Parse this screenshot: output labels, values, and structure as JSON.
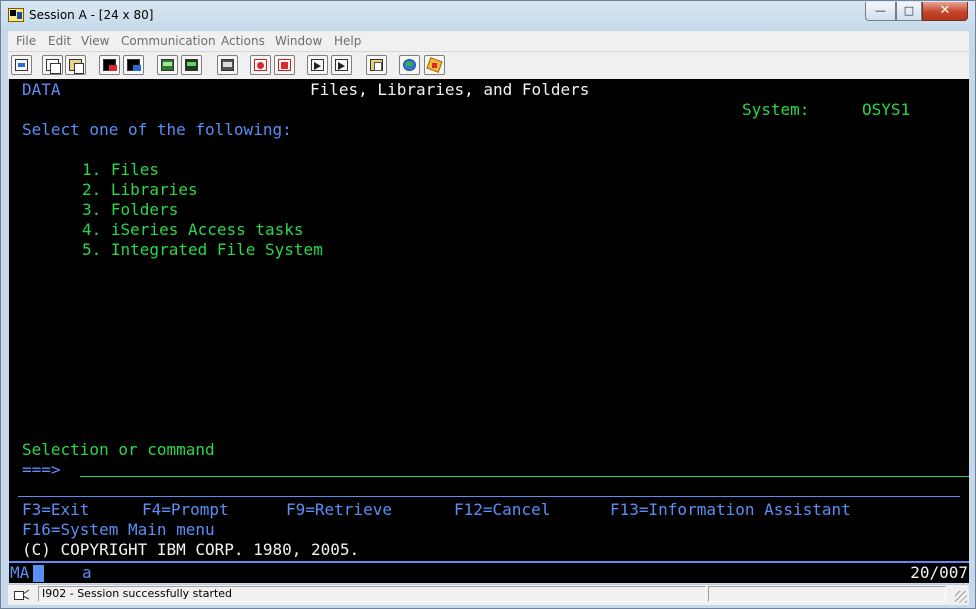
{
  "window": {
    "title": "Session A - [24 x 80]",
    "controls": {
      "minimize": "—",
      "maximize": "□",
      "close": "✕"
    }
  },
  "menu": [
    "File",
    "Edit",
    "View",
    "Communication",
    "Actions",
    "Window",
    "Help"
  ],
  "toolbar": {
    "tools": [
      "print-screen",
      "copy",
      "paste",
      "send",
      "receive",
      "display-keypad",
      "keypad",
      "macro",
      "record-macro",
      "stop-macro",
      "play-macro",
      "play-macro-2",
      "clipboard",
      "connect",
      "disconnect"
    ]
  },
  "screen": {
    "menu_id": "DATA",
    "title": "Files, Libraries, and Folders",
    "system_label": "System:",
    "system_name": "OSYS1",
    "prompt": "Select one of the following:",
    "options": [
      "1. Files",
      "2. Libraries",
      "3. Folders",
      "4. iSeries Access tasks",
      "5. Integrated File System"
    ],
    "selection_label": "Selection or command",
    "command_prompt": "===>",
    "command_value": "",
    "function_keys": [
      "F3=Exit",
      "F4=Prompt",
      "F9=Retrieve",
      "F12=Cancel",
      "F13=Information Assistant",
      "F16=System Main menu"
    ],
    "copyright": "(C) COPYRIGHT IBM CORP. 1980, 2005."
  },
  "oia": {
    "indicator": "MA",
    "input_char": "a",
    "cursor_position": "20/007"
  },
  "statusbar": {
    "message": "I902 - Session successfully started"
  },
  "colors": {
    "screen_bg": "#000000",
    "blue": "#5b8ef5",
    "green": "#28d84a",
    "white": "#f2f2f2"
  }
}
